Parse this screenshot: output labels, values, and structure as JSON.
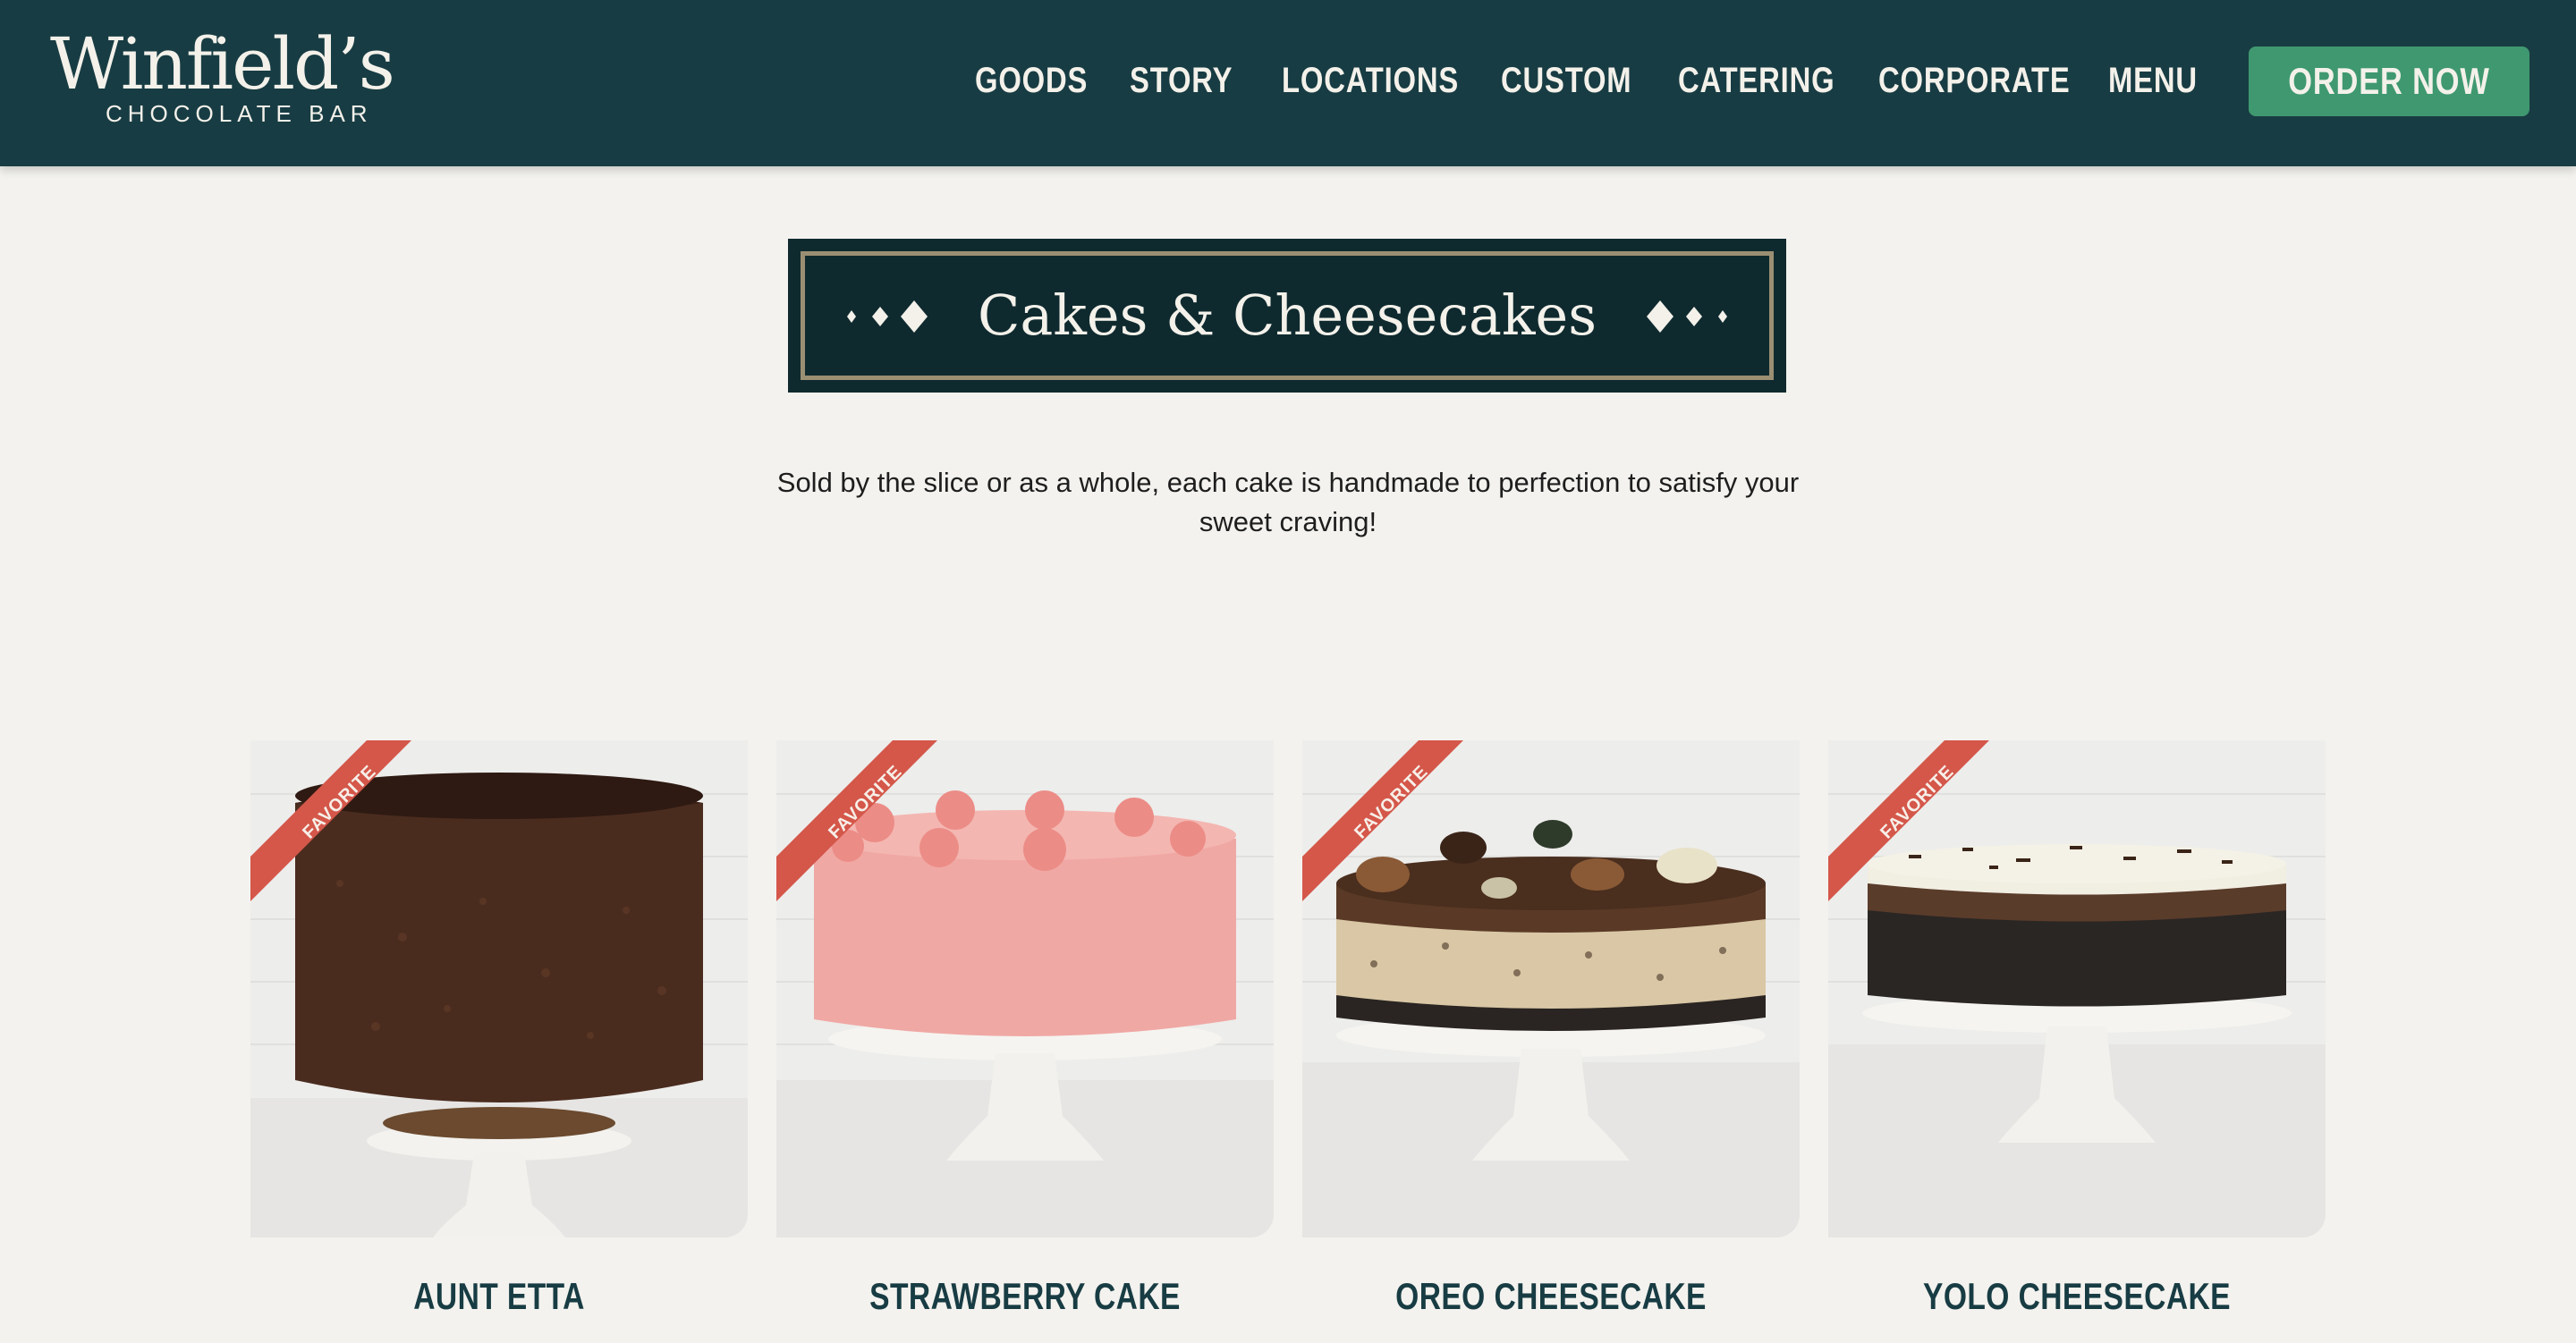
{
  "brand": {
    "name": "Winfield’s",
    "tagline": "CHOCOLATE BAR"
  },
  "nav": {
    "items": [
      "GOODS",
      "STORY",
      "LOCATIONS",
      "CUSTOM",
      "CATERING",
      "CORPORATE",
      "MENU"
    ],
    "order_label": "ORDER NOW"
  },
  "section": {
    "title": "Cakes & Cheesecakes",
    "intro": "Sold by the slice or as a whole, each cake is handmade to perfection to satisfy your sweet craving!"
  },
  "products": [
    {
      "name": "AUNT ETTA",
      "badge": "FAVORITE"
    },
    {
      "name": "STRAWBERRY CAKE",
      "badge": "FAVORITE"
    },
    {
      "name": "OREO CHEESECAKE",
      "badge": "FAVORITE"
    },
    {
      "name": "YOLO CHEESECAKE",
      "badge": "FAVORITE"
    }
  ],
  "colors": {
    "header_bg": "#183c43",
    "page_bg": "#f3f2ee",
    "order_button": "#3f9870",
    "banner_bg": "#0f2a2f",
    "banner_border": "#9b8f73",
    "ribbon": "#d4574a"
  }
}
